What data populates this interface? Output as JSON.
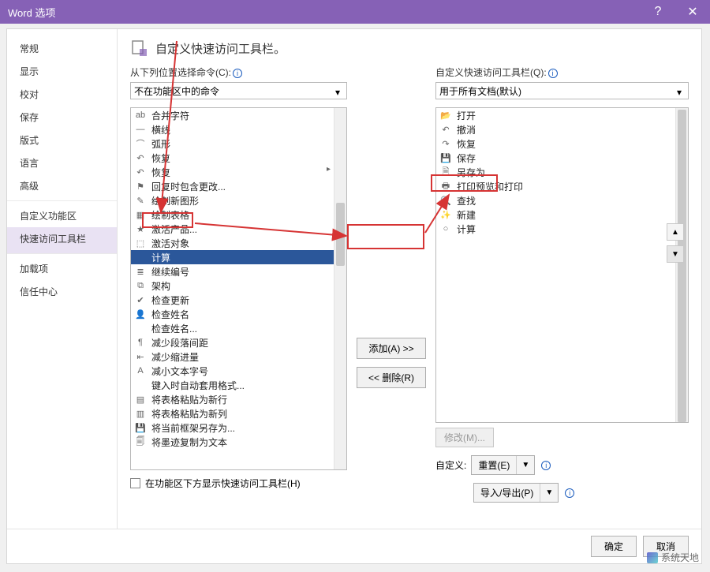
{
  "title_bar": {
    "title": "Word 选项",
    "help": "?",
    "close": "✕"
  },
  "sidebar": {
    "items": [
      {
        "label": "常规"
      },
      {
        "label": "显示"
      },
      {
        "label": "校对"
      },
      {
        "label": "保存"
      },
      {
        "label": "版式"
      },
      {
        "label": "语言"
      },
      {
        "label": "高级"
      },
      {
        "label": "自定义功能区"
      },
      {
        "label": "快速访问工具栏",
        "selected": true
      },
      {
        "label": "加载项"
      },
      {
        "label": "信任中心"
      }
    ]
  },
  "content": {
    "heading": "自定义快速访问工具栏。",
    "left": {
      "label": "从下列位置选择命令(C):",
      "dropdown": "不在功能区中的命令"
    },
    "right": {
      "label": "自定义快速访问工具栏(Q):",
      "dropdown": "用于所有文档(默认)"
    },
    "left_items": [
      {
        "icon": "ab",
        "label": "合并字符"
      },
      {
        "icon": "—",
        "label": "横线"
      },
      {
        "icon": "⌒",
        "label": "弧形"
      },
      {
        "icon": "↶",
        "label": "恢复",
        "expand": true
      },
      {
        "icon": "↶",
        "label": "恢复"
      },
      {
        "icon": "⚑",
        "label": "回复时包含更改..."
      },
      {
        "icon": "✎",
        "label": "绘制新图形"
      },
      {
        "icon": "▦",
        "label": "绘制表格"
      },
      {
        "icon": "★",
        "label": "激活产品..."
      },
      {
        "icon": "⬚",
        "label": "激活对象"
      },
      {
        "icon": "",
        "label": "计算",
        "selected": true
      },
      {
        "icon": "≣",
        "label": "继续编号"
      },
      {
        "icon": "⧉",
        "label": "架构"
      },
      {
        "icon": "✔",
        "label": "检查更新"
      },
      {
        "icon": "👤",
        "label": "检查姓名"
      },
      {
        "icon": "",
        "label": "检查姓名..."
      },
      {
        "icon": "¶",
        "label": "减少段落间距"
      },
      {
        "icon": "⇤",
        "label": "减少缩进量"
      },
      {
        "icon": "A",
        "label": "减小文本字号"
      },
      {
        "icon": "",
        "label": "键入时自动套用格式..."
      },
      {
        "icon": "▤",
        "label": "将表格粘贴为新行"
      },
      {
        "icon": "▥",
        "label": "将表格粘贴为新列"
      },
      {
        "icon": "💾",
        "label": "将当前框架另存为..."
      },
      {
        "icon": "🗐",
        "label": "将墨迹复制为文本"
      }
    ],
    "right_items": [
      {
        "icon": "📂",
        "label": "打开"
      },
      {
        "icon": "↶",
        "label": "撤消"
      },
      {
        "icon": "↷",
        "label": "恢复"
      },
      {
        "icon": "💾",
        "label": "保存"
      },
      {
        "icon": "🗎",
        "label": "另存为"
      },
      {
        "icon": "🖶",
        "label": "打印预览和打印"
      },
      {
        "icon": "🔍",
        "label": "查找"
      },
      {
        "icon": "✨",
        "label": "新建"
      },
      {
        "icon": "○",
        "label": "计算"
      }
    ],
    "buttons": {
      "add": "添加(A) >>",
      "remove": "<< 删除(R)",
      "modify": "修改(M)...",
      "customize_label": "自定义:",
      "reset": "重置(E)",
      "import_export": "导入/导出(P)",
      "below_ribbon": "在功能区下方显示快速访问工具栏(H)"
    }
  },
  "footer": {
    "ok": "确定",
    "cancel": "取消"
  },
  "watermark": "系统天地"
}
